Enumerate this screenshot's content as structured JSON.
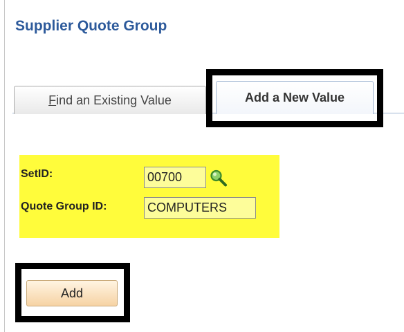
{
  "page": {
    "title": "Supplier Quote Group"
  },
  "tabs": [
    {
      "label_first": "F",
      "label_rest": "ind an Existing Value",
      "selected": false
    },
    {
      "label": "Add a New Value",
      "selected": true
    }
  ],
  "form": {
    "setid_label": "SetID:",
    "setid_value": "00700",
    "quote_group_label": "Quote Group ID:",
    "quote_group_value": "COMPUTERS"
  },
  "actions": {
    "add_label": "Add"
  },
  "colors": {
    "title": "#2d5a9b",
    "highlight": "#fffc3b",
    "callout_border": "#000000"
  },
  "icons": {
    "lookup": "magnifier-lookup-icon"
  }
}
